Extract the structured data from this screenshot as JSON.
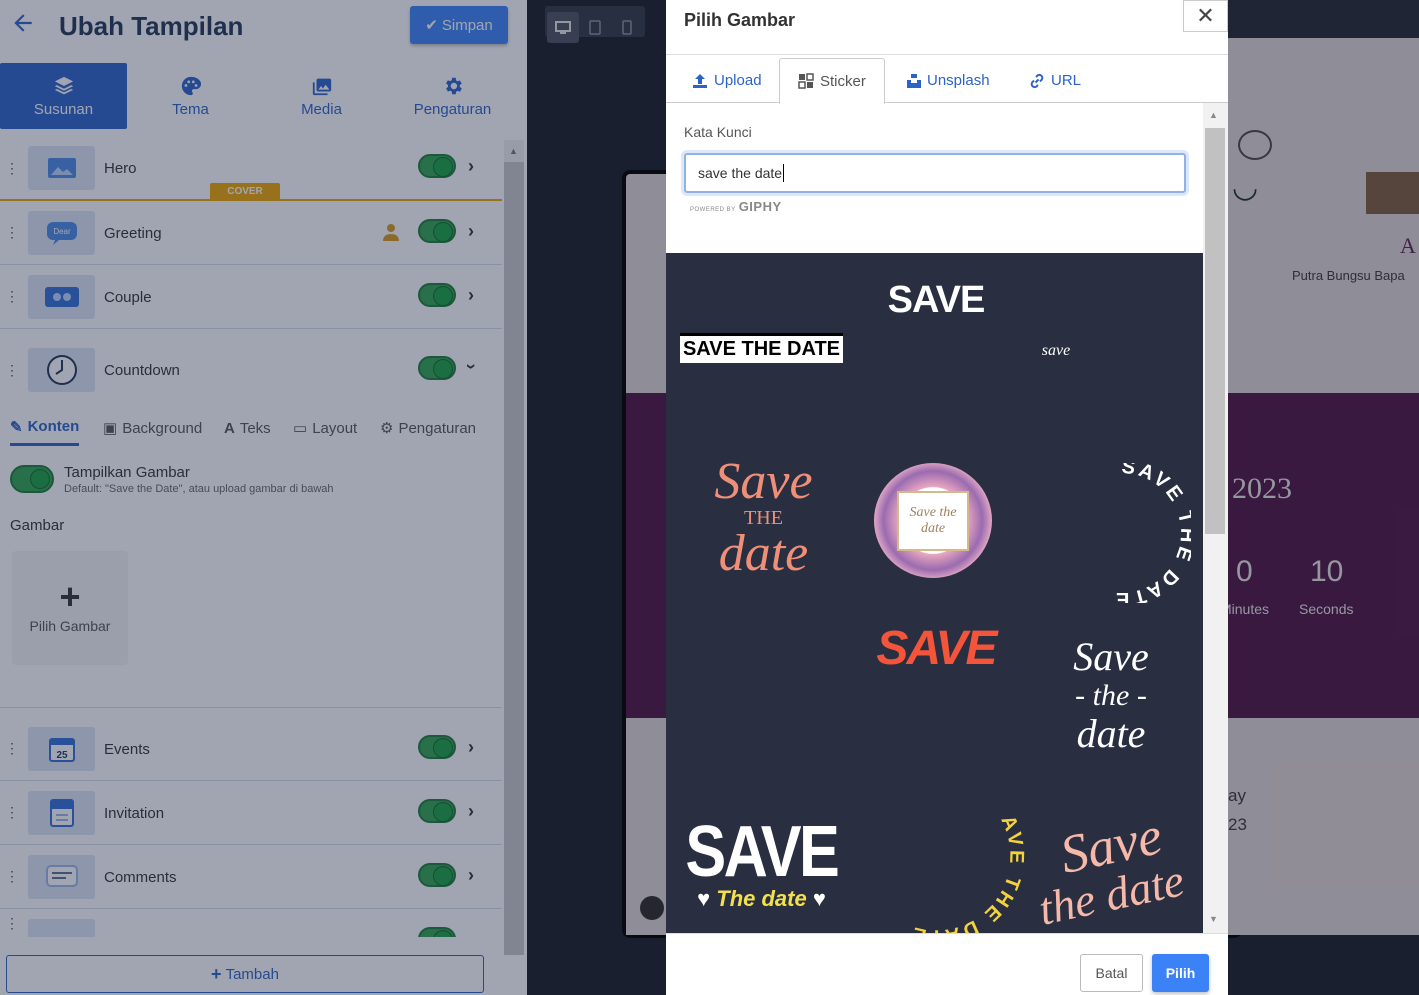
{
  "sidebar": {
    "title": "Ubah Tampilan",
    "save_label": "Simpan",
    "tabs": [
      {
        "label": "Susunan",
        "icon": "layers-icon"
      },
      {
        "label": "Tema",
        "icon": "palette-icon"
      },
      {
        "label": "Media",
        "icon": "images-icon"
      },
      {
        "label": "Pengaturan",
        "icon": "gear-icon"
      }
    ],
    "sections": [
      {
        "label": "Hero",
        "enabled": true
      },
      {
        "label": "Greeting",
        "enabled": true
      },
      {
        "label": "Couple",
        "enabled": true
      },
      {
        "label": "Countdown",
        "enabled": true
      },
      {
        "label": "Events",
        "enabled": true
      },
      {
        "label": "Invitation",
        "enabled": true
      },
      {
        "label": "Comments",
        "enabled": true
      }
    ],
    "cover_badge": "COVER",
    "greeting_thumb_text": "Dear",
    "events_thumb_text": "25",
    "countdown_tabs": [
      "Konten",
      "Background",
      "Teks",
      "Layout",
      "Pengaturan"
    ],
    "show_image_label": "Tampilkan Gambar",
    "show_image_hint": "Default: \"Save the Date\", atau upload gambar di bawah",
    "image_label": "Gambar",
    "pick_image_label": "Pilih Gambar",
    "add_label": "Tambah"
  },
  "preview": {
    "partial_name": "Putra Bungsu Bapa",
    "year": "2023",
    "minutes_value": "0",
    "minutes_label": "Minutes",
    "seconds_value": "10",
    "seconds_label": "Seconds",
    "day_fragment": "ay",
    "date_fragment": "23",
    "letter_fragment": "A"
  },
  "modal": {
    "title": "Pilih Gambar",
    "close_glyph": "✕",
    "tabs": [
      {
        "label": "Upload",
        "icon": "upload-icon"
      },
      {
        "label": "Sticker",
        "icon": "sticker-icon",
        "active": true
      },
      {
        "label": "Unsplash",
        "icon": "unsplash-icon"
      },
      {
        "label": "URL",
        "icon": "link-icon"
      }
    ],
    "keyword_label": "Kata Kunci",
    "keyword_value": "save the date",
    "powered_by": "POWERED BY",
    "giphy": "GIPHY",
    "cancel_label": "Batal",
    "pick_label": "Pilih",
    "stickers": {
      "save_white": "SAVE",
      "save_the_date_box": "SAVE THE DATE",
      "save_script": "save",
      "save_pink_1": "Save",
      "save_pink_2": "THE",
      "save_pink_3": "date",
      "floral_1": "Save the",
      "floral_2": "date",
      "arc_white": "SAVE THE DATE",
      "save_orange": "SAVE",
      "hand_1": "Save",
      "hand_2": "- the -",
      "hand_3": "date",
      "big_save": "SAVE",
      "big_the_date": "The date",
      "arc_yellow": "SAVE THE DATE",
      "peach_1": "Save",
      "peach_2": "the date"
    }
  }
}
